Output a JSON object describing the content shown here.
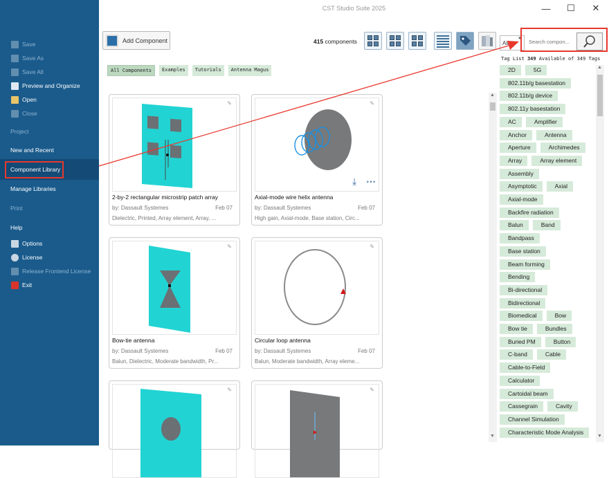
{
  "app_title": "CST Studio Suite 2025",
  "window_controls": {
    "minimize": "—",
    "maximize": "☐",
    "close": "✕"
  },
  "sidebar": {
    "save": "Save",
    "save_as": "Save As",
    "save_all": "Save All",
    "preview": "Preview and Organize",
    "open": "Open",
    "close": "Close",
    "project": "Project",
    "new_recent": "New and Recent",
    "component_library": "Component Library",
    "manage_libraries": "Manage Libraries",
    "print": "Print",
    "help": "Help",
    "options": "Options",
    "license": "License",
    "release_license": "Release Frontend License",
    "exit": "Exit"
  },
  "toolbar": {
    "add_component": "Add Component",
    "count_number": "415",
    "count_suffix": " components",
    "filter_value": "All",
    "search_placeholder": "Search compon..."
  },
  "categories": [
    "All Components",
    "Examples",
    "Tutorials",
    "Antenna Magus"
  ],
  "cards": [
    {
      "title": "2-by-2 rectangular microstrip patch array",
      "author": "by: Dassault Systemes",
      "date": "Feb 07",
      "tags": "Dielectric, Printed, Array element, Array, ..."
    },
    {
      "title": "Axial-mode wire helix antenna",
      "author": "by: Dassault Systemes",
      "date": "Feb 07",
      "tags": "High gain, Axial-mode, Base station, Circ..."
    },
    {
      "title": "Bow-tie antenna",
      "author": "by: Dassault Systemes",
      "date": "Feb 07",
      "tags": "Balun, Dielectric, Moderate bandwidth, Pr..."
    },
    {
      "title": "Circular loop antenna",
      "author": "by: Dassault Systemes",
      "date": "Feb 07",
      "tags": "Balun, Moderate bandwidth, Array eleme..."
    }
  ],
  "tag_header": {
    "prefix": "Tag List ",
    "count": "349",
    "suffix": " Available of 349 Tags"
  },
  "tags": [
    [
      "2D",
      "5G"
    ],
    [
      "802.11b/g basestation"
    ],
    [
      "802.11b/g device"
    ],
    [
      "802.11y basestation"
    ],
    [
      "AC",
      "Amplifier"
    ],
    [
      "Anchor",
      "Antenna"
    ],
    [
      "Aperture",
      "Archimedes"
    ],
    [
      "Array",
      "Array element"
    ],
    [
      "Assembly"
    ],
    [
      "Asymptotic",
      "Axial"
    ],
    [
      "Axial-mode"
    ],
    [
      "Backfire radiation"
    ],
    [
      "Balun",
      "Band"
    ],
    [
      "Bandpass"
    ],
    [
      "Base station"
    ],
    [
      "Beam forming"
    ],
    [
      "Bending"
    ],
    [
      "Bi-directional"
    ],
    [
      "Bidirectional"
    ],
    [
      "Biomedical",
      "Bow"
    ],
    [
      "Bow tie",
      "Bundles"
    ],
    [
      "Buried PM",
      "Button"
    ],
    [
      "C-band",
      "Cable"
    ],
    [
      "Cable-to-Field"
    ],
    [
      "Calculator"
    ],
    [
      "Cartoidal beam"
    ],
    [
      "Cassegrain",
      "Cavity"
    ],
    [
      "Channel Simulation"
    ],
    [
      "Characteristic Mode Analysis"
    ]
  ],
  "colors": {
    "sidebar": "#1a5b8c",
    "accent_red": "#e8382e",
    "tag_bg": "#d6ead9",
    "cyan": "#22d3d3"
  }
}
